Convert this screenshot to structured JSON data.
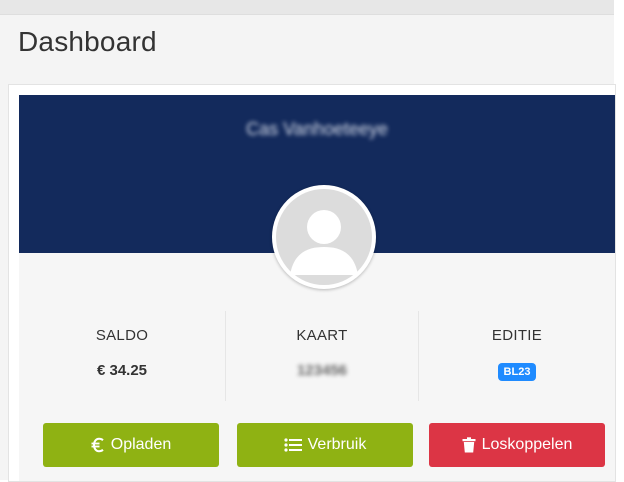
{
  "page": {
    "title": "Dashboard"
  },
  "profile": {
    "name": "Cas Vanhoeteeye"
  },
  "stats": [
    {
      "label": "SALDO",
      "value": "€ 34.25"
    },
    {
      "label": "KAART",
      "value": "123456"
    },
    {
      "label": "EDITIE",
      "value": "BL23"
    }
  ],
  "actions": [
    {
      "label": "Opladen",
      "icon": "euro-icon",
      "color": "#8fb213"
    },
    {
      "label": "Verbruik",
      "icon": "list-icon",
      "color": "#8fb213"
    },
    {
      "label": "Loskoppelen",
      "icon": "trash-icon",
      "color": "#dc3545"
    }
  ],
  "colors": {
    "banner": "#132a5c",
    "badge": "#1f8bff"
  }
}
